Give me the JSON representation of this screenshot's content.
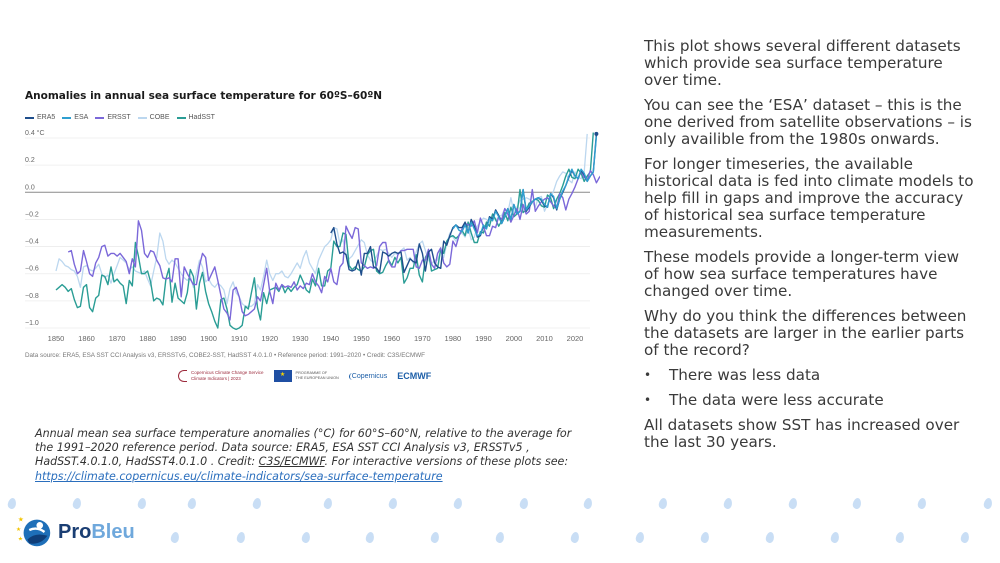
{
  "chart_data": {
    "type": "line",
    "title": "Anomalies in annual sea surface temperature for 60ºS–60ºN",
    "xlabel": "",
    "ylabel": "°C",
    "y_unit_label": "0.4 °C",
    "xlim": [
      1845,
      2025
    ],
    "ylim": [
      -1.05,
      0.45
    ],
    "x_ticks": [
      "1850",
      "1860",
      "1870",
      "1880",
      "1890",
      "1900",
      "1910",
      "1920",
      "1930",
      "1940",
      "1950",
      "1960",
      "1970",
      "1980",
      "1990",
      "2000",
      "2010",
      "2020"
    ],
    "y_ticks": [
      {
        "value": 0.4,
        "label": "0.4 °C"
      },
      {
        "value": 0.2,
        "label": "0.2"
      },
      {
        "value": 0.0,
        "label": "0.0"
      },
      {
        "value": -0.2,
        "label": "−0.2"
      },
      {
        "value": -0.4,
        "label": "−0.4"
      },
      {
        "value": -0.6,
        "label": "−0.6"
      },
      {
        "value": -0.8,
        "label": "−0.8"
      },
      {
        "value": -1.0,
        "label": "−1.0"
      }
    ],
    "grid": true,
    "legend_position": "top-left",
    "series": [
      {
        "name": "COBE",
        "color": "#bcd7ef",
        "start_year": 1850,
        "values": [
          -0.58,
          -0.49,
          -0.51,
          -0.54,
          -0.55,
          -0.57,
          -0.58,
          -0.62,
          -0.7,
          -0.55,
          -0.54,
          -0.57,
          -0.58,
          -0.56,
          -0.53,
          -0.6,
          -0.63,
          -0.61,
          -0.67,
          -0.6,
          -0.54,
          -0.48,
          -0.5,
          -0.52,
          -0.57,
          -0.55,
          -0.58,
          -0.59,
          -0.6,
          -0.58,
          -0.64,
          -0.69,
          -0.58,
          -0.48,
          -0.3,
          -0.36,
          -0.49,
          -0.53,
          -0.5,
          -0.52,
          -0.56,
          -0.6,
          -0.63,
          -0.65,
          -0.62,
          -0.7,
          -0.6,
          -0.5,
          -0.55,
          -0.66,
          -0.64,
          -0.68,
          -0.7,
          -0.67,
          -0.69,
          -0.72,
          -0.82,
          -0.71,
          -0.66,
          -0.74,
          -0.77,
          -0.82,
          -0.84,
          -0.84,
          -0.84,
          -0.82,
          -0.68,
          -0.72,
          -0.62,
          -0.5,
          -0.6,
          -0.65,
          -0.6,
          -0.6,
          -0.58,
          -0.62,
          -0.63,
          -0.6,
          -0.56,
          -0.52,
          -0.56,
          -0.48,
          -0.43,
          -0.52,
          -0.56,
          -0.6,
          -0.5,
          -0.45,
          -0.4,
          -0.38,
          -0.35,
          -0.26,
          -0.27,
          -0.38,
          -0.35,
          -0.45,
          -0.49,
          -0.47,
          -0.43,
          -0.39,
          -0.35,
          -0.37,
          -0.46,
          -0.5,
          -0.52,
          -0.47,
          -0.42,
          -0.43,
          -0.42,
          -0.45,
          -0.48,
          -0.45,
          -0.46,
          -0.43,
          -0.41,
          -0.5,
          -0.48,
          -0.52,
          -0.44,
          -0.38,
          -0.36,
          -0.43,
          -0.5,
          -0.53,
          -0.5,
          -0.5,
          -0.43,
          -0.48,
          -0.38,
          -0.3,
          -0.33,
          -0.36,
          -0.31,
          -0.3,
          -0.33,
          -0.26,
          -0.35,
          -0.33,
          -0.25,
          -0.22,
          -0.19,
          -0.2,
          -0.22,
          -0.16,
          -0.21,
          -0.18,
          -0.17,
          -0.12,
          -0.15,
          -0.04,
          -0.15,
          -0.11,
          -0.06,
          -0.05,
          -0.04,
          -0.05,
          -0.07,
          -0.11,
          -0.04,
          -0.03,
          -0.14,
          -0.09,
          -0.04,
          0.01,
          0.08,
          0.12,
          0.15,
          0.14,
          0.09,
          0.07,
          0.15,
          0.11,
          0.1,
          0.15,
          0.43
        ]
      },
      {
        "name": "HadSST",
        "color": "#2a9d95",
        "start_year": 1850,
        "values": [
          -0.72,
          -0.7,
          -0.68,
          -0.7,
          -0.73,
          -0.71,
          -0.79,
          -0.85,
          -0.84,
          -0.7,
          -0.68,
          -0.85,
          -0.88,
          -0.78,
          -0.76,
          -0.61,
          -0.62,
          -0.68,
          -0.55,
          -0.66,
          -0.64,
          -0.67,
          -0.69,
          -0.82,
          -0.65,
          -0.69,
          -0.37,
          -0.47,
          -0.6,
          -0.6,
          -0.58,
          -0.66,
          -0.8,
          -0.78,
          -0.79,
          -0.83,
          -0.64,
          -0.56,
          -0.81,
          -0.67,
          -0.78,
          -0.8,
          -0.82,
          -0.74,
          -0.57,
          -0.62,
          -0.86,
          -0.67,
          -0.59,
          -0.73,
          -0.82,
          -0.88,
          -0.95,
          -1.0,
          -0.79,
          -0.78,
          -0.86,
          -0.98,
          -1.0,
          -1.01,
          -1.0,
          -0.98,
          -0.84,
          -0.86,
          -0.74,
          -0.63,
          -0.85,
          -0.94,
          -0.74,
          -0.82,
          -0.72,
          -0.71,
          -0.7,
          -0.73,
          -0.68,
          -0.74,
          -0.7,
          -0.73,
          -0.7,
          -0.68,
          -0.61,
          -0.66,
          -0.72,
          -0.74,
          -0.64,
          -0.69,
          -0.56,
          -0.69,
          -0.69,
          -0.58,
          -0.56,
          -0.36,
          -0.4,
          -0.4,
          -0.3,
          -0.31,
          -0.54,
          -0.57,
          -0.55,
          -0.57,
          -0.58,
          -0.55,
          -0.46,
          -0.43,
          -0.42,
          -0.58,
          -0.6,
          -0.59,
          -0.54,
          -0.5,
          -0.54,
          -0.48,
          -0.52,
          -0.48,
          -0.67,
          -0.63,
          -0.56,
          -0.56,
          -0.46,
          -0.61,
          -0.66,
          -0.48,
          -0.44,
          -0.58,
          -0.57,
          -0.56,
          -0.42,
          -0.45,
          -0.36,
          -0.33,
          -0.32,
          -0.34,
          -0.32,
          -0.28,
          -0.32,
          -0.22,
          -0.3,
          -0.37,
          -0.37,
          -0.29,
          -0.3,
          -0.22,
          -0.25,
          -0.16,
          -0.2,
          -0.25,
          -0.21,
          -0.15,
          -0.21,
          -0.11,
          -0.18,
          -0.16,
          0.02,
          -0.15,
          -0.13,
          -0.08,
          -0.07,
          -0.05,
          -0.06,
          -0.1,
          -0.11,
          -0.02,
          -0.04,
          -0.12,
          -0.05,
          -0.01,
          0.05,
          0.12,
          0.17,
          0.11,
          0.1,
          0.17,
          0.14,
          0.08,
          0.12,
          0.15,
          0.44
        ]
      },
      {
        "name": "ERSST",
        "color": "#7b68d9",
        "start_year": 1854,
        "values": [
          -0.44,
          -0.43,
          -0.53,
          -0.6,
          -0.58,
          -0.43,
          -0.51,
          -0.6,
          -0.62,
          -0.52,
          -0.48,
          -0.4,
          -0.39,
          -0.47,
          -0.45,
          -0.45,
          -0.47,
          -0.45,
          -0.48,
          -0.51,
          -0.6,
          -0.49,
          -0.55,
          -0.21,
          -0.28,
          -0.45,
          -0.48,
          -0.43,
          -0.44,
          -0.5,
          -0.54,
          -0.63,
          -0.64,
          -0.63,
          -0.66,
          -0.49,
          -0.49,
          -0.77,
          -0.55,
          -0.6,
          -0.64,
          -0.68,
          -0.68,
          -0.54,
          -0.45,
          -0.48,
          -0.65,
          -0.6,
          -0.55,
          -0.65,
          -0.76,
          -0.86,
          -0.89,
          -0.94,
          -0.72,
          -0.7,
          -0.77,
          -0.88,
          -0.91,
          -0.9,
          -0.88,
          -0.86,
          -0.77,
          -0.8,
          -0.68,
          -0.56,
          -0.73,
          -0.82,
          -0.67,
          -0.72,
          -0.68,
          -0.7,
          -0.69,
          -0.7,
          -0.66,
          -0.72,
          -0.69,
          -0.71,
          -0.67,
          -0.68,
          -0.6,
          -0.66,
          -0.69,
          -0.74,
          -0.62,
          -0.66,
          -0.56,
          -0.66,
          -0.68,
          -0.55,
          -0.52,
          -0.25,
          -0.3,
          -0.34,
          -0.26,
          -0.27,
          -0.52,
          -0.54,
          -0.56,
          -0.55,
          -0.56,
          -0.54,
          -0.4,
          -0.37,
          -0.37,
          -0.51,
          -0.55,
          -0.55,
          -0.46,
          -0.43,
          -0.43,
          -0.42,
          -0.42,
          -0.42,
          -0.55,
          -0.56,
          -0.5,
          -0.5,
          -0.42,
          -0.53,
          -0.56,
          -0.45,
          -0.41,
          -0.52,
          -0.55,
          -0.53,
          -0.36,
          -0.4,
          -0.32,
          -0.27,
          -0.23,
          -0.24,
          -0.25,
          -0.21,
          -0.3,
          -0.19,
          -0.25,
          -0.32,
          -0.32,
          -0.25,
          -0.26,
          -0.18,
          -0.2,
          -0.12,
          -0.16,
          -0.22,
          -0.17,
          -0.12,
          -0.2,
          -0.09,
          -0.16,
          -0.14,
          0.02,
          -0.14,
          -0.1,
          -0.07,
          -0.05,
          -0.04,
          -0.07,
          -0.1,
          -0.12,
          -0.01,
          -0.04,
          -0.13,
          -0.05,
          -0.01,
          0.04,
          0.1,
          0.16,
          0.11,
          0.09,
          0.16,
          0.13,
          0.07,
          0.11,
          0.14,
          0.42
        ]
      },
      {
        "name": "ERA5",
        "color": "#1f4e8c",
        "start_year": 1940,
        "values": [
          -0.3,
          -0.26,
          -0.38,
          -0.45,
          -0.44,
          -0.46,
          -0.57,
          -0.58,
          -0.57,
          -0.5,
          -0.61,
          -0.45,
          -0.45,
          -0.4,
          -0.55,
          -0.56,
          -0.59,
          -0.44,
          -0.45,
          -0.47,
          -0.45,
          -0.44,
          -0.45,
          -0.44,
          -0.59,
          -0.54,
          -0.49,
          -0.51,
          -0.52,
          -0.38,
          -0.45,
          -0.58,
          -0.44,
          -0.42,
          -0.52,
          -0.55,
          -0.56,
          -0.36,
          -0.39,
          -0.32,
          -0.26,
          -0.24,
          -0.26,
          -0.26,
          -0.22,
          -0.3,
          -0.2,
          -0.25,
          -0.33,
          -0.32,
          -0.25,
          -0.26,
          -0.18,
          -0.2,
          -0.13,
          -0.17,
          -0.23,
          -0.18,
          -0.12,
          -0.2,
          -0.09,
          -0.16,
          -0.14,
          0.02,
          -0.14,
          -0.11,
          -0.07,
          -0.05,
          -0.04,
          -0.06,
          -0.1,
          -0.11,
          -0.01,
          -0.04,
          -0.13,
          -0.05,
          0.0,
          0.05,
          0.11,
          0.16,
          0.12,
          0.1,
          0.16,
          0.13,
          0.08,
          0.12,
          0.15,
          0.43
        ]
      },
      {
        "name": "ESA",
        "color": "#2f9fd0",
        "start_year": 1980,
        "values": [
          -0.27,
          -0.24,
          -0.28,
          -0.29,
          -0.24,
          -0.3,
          -0.22,
          -0.27,
          -0.32,
          -0.31,
          -0.24,
          -0.27,
          -0.19,
          -0.21,
          -0.14,
          -0.18,
          -0.23,
          -0.18,
          -0.12,
          -0.2,
          -0.09,
          -0.16,
          -0.14,
          0.02,
          -0.13,
          -0.1,
          -0.07,
          -0.05,
          -0.04,
          -0.05,
          -0.09,
          -0.11,
          -0.01,
          -0.03,
          -0.12,
          -0.05,
          0.01,
          0.05,
          0.12,
          0.17,
          0.12,
          0.1,
          0.17,
          0.14,
          0.08,
          0.12,
          0.15,
          0.41
        ]
      }
    ],
    "source": "Data source: ERA5, ESA SST CCI Analysis v3, ERSSTv5, COBE2-SST, HadSST 4.0.1.0 • Reference period: 1991–2020 • Credit: C3S/ECMWF"
  },
  "logos": {
    "c3s_line1": "Copernicus Climate Change Service",
    "c3s_line2": "Climate Indicators | 2023",
    "eu_line1": "PROGRAMME OF",
    "eu_line2": "THE EUROPEAN UNION",
    "eu_flag_icon": "★",
    "copernicus": "Copernicus",
    "ecmwf": "ECMWF"
  },
  "caption": {
    "text": "Annual mean sea surface temperature anomalies (°C) for 60°S–60°N, relative to the average for the 1991–2020 reference period. Data source: ERA5, ESA SST CCI Analysis v3, ERSSTv5 , HadSST.4.0.1.0, HadSST4.0.1.0 . Credit: ",
    "credit_link": "C3S/ECMWF",
    "after_credit": ". For interactive versions of these plots see: ",
    "url": "https://climate.copernicus.eu/climate-indicators/sea-surface-temperature"
  },
  "right_panel": {
    "p1": "This plot shows several different datasets which provide sea surface temperature over time.",
    "p2": "You can see the ‘ESA’ dataset – this is the one derived from satellite observations – is only availible from the 1980s onwards.",
    "p3": "For longer timeseries, the available historical data is fed into climate models to help fill in gaps and improve the accuracy of historical sea surface temperature measurements.",
    "p4": "These models provide a longer-term view of how sea surface temperatures have changed over time.",
    "p5": "Why do you think the differences between the datasets are larger in the earlier parts of the record?",
    "bullets": [
      "There was less data",
      "The data were less accurate"
    ],
    "bullet_glyph": "•",
    "p6": "All datasets show SST has increased over the last 30 years."
  },
  "brand": {
    "pro": "Pro",
    "bleu": "Bleu"
  }
}
